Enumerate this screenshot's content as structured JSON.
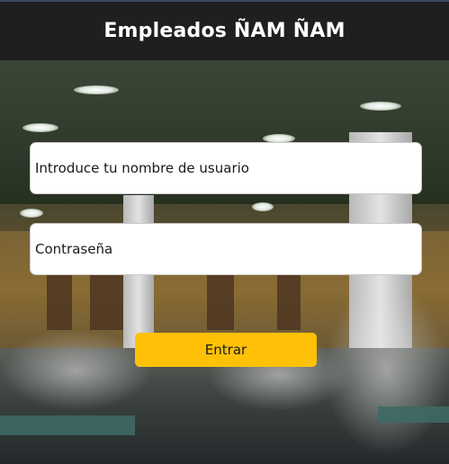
{
  "header": {
    "title": "Empleados ÑAM ÑAM"
  },
  "login": {
    "username_placeholder": "Introduce tu nombre de usuario",
    "password_placeholder": "Contraseña",
    "submit_label": "Entrar"
  },
  "colors": {
    "header_bg": "#1f1f1f",
    "button_bg": "#ffc107",
    "field_bg": "#ffffff"
  },
  "background": {
    "description_icon": "cafeteria-background-image"
  }
}
